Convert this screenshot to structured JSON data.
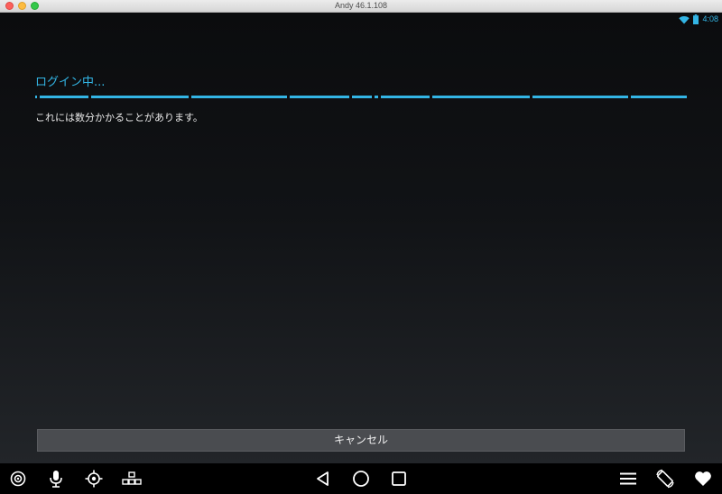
{
  "window": {
    "title": "Andy 46.1.108"
  },
  "statusbar": {
    "time": "4:08",
    "accent": "#33b5e5"
  },
  "dialog": {
    "title": "ログイン中...",
    "message": "これには数分かかることがあります。",
    "cancel_label": "キャンセル"
  },
  "progress": {
    "indeterminate": true
  },
  "navbar": {
    "left_icons": [
      "gps-location-icon",
      "microphone-icon",
      "target-crosshair-icon",
      "keyboard-mapping-icon"
    ],
    "center_icons": [
      "back-icon",
      "home-icon",
      "recent-apps-icon"
    ],
    "right_icons": [
      "menu-icon",
      "rotate-screen-icon",
      "heart-icon"
    ]
  }
}
